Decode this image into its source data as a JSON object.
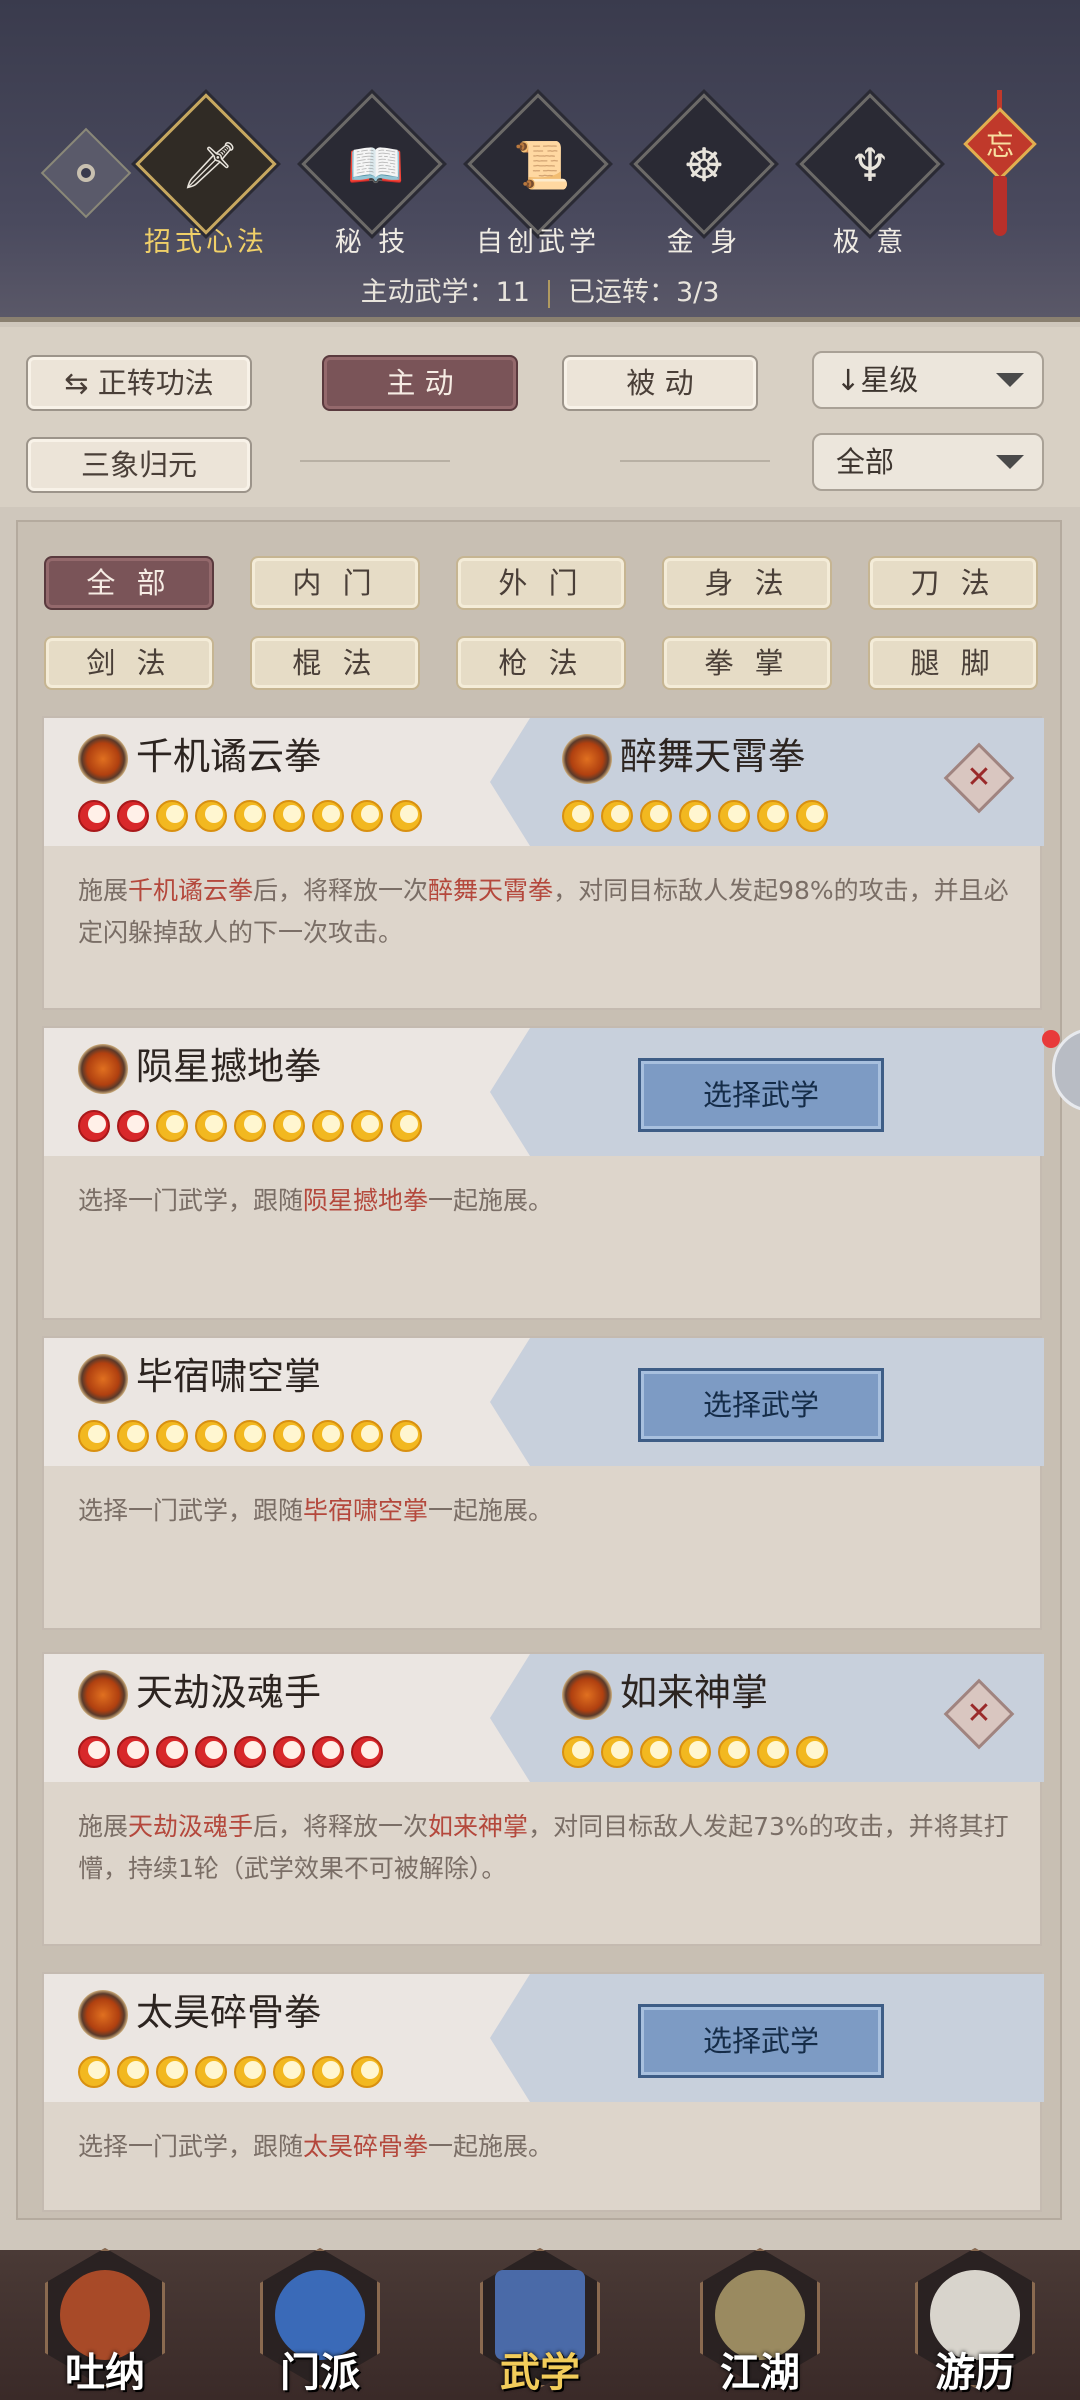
{
  "header": {
    "tabs": [
      {
        "label": "招式心法",
        "icon": "sword-icon",
        "selected": true
      },
      {
        "label": "秘 技",
        "icon": "scroll-book-icon",
        "selected": false
      },
      {
        "label": "自创武学",
        "icon": "rolled-scroll-icon",
        "selected": false
      },
      {
        "label": "金 身",
        "icon": "meditation-icon",
        "selected": false
      },
      {
        "label": "极 意",
        "icon": "martial-pose-icon",
        "selected": false
      }
    ],
    "knot_char": "忘",
    "active_label": "主动武学：11",
    "running_label": "已运转：3/3"
  },
  "filters": {
    "switch_label": "正转功法",
    "active_label": "主 动",
    "passive_label": "被 动",
    "sort_label": "星级",
    "mode_label": "三象归元",
    "all_label": "全部"
  },
  "categories": [
    "全 部",
    "内 门",
    "外 门",
    "身 法",
    "刀 法",
    "剑 法",
    "棍 法",
    "枪 法",
    "拳 掌",
    "腿 脚"
  ],
  "combos": [
    {
      "left_name": "千机谲云拳",
      "left_red": 2,
      "left_total": 9,
      "right_name": "醉舞天霄拳",
      "right_red": 0,
      "right_total": 7,
      "desc_pre": "施展",
      "desc_a": "千机谲云拳",
      "desc_mid": "后，将释放一次",
      "desc_b": "醉舞天霄拳",
      "desc_post": "，对同目标敌人发起98%的攻击，并且必定闪躲掉敌人的下一次攻击。"
    },
    {
      "left_name": "陨星撼地拳",
      "left_red": 2,
      "left_total": 9,
      "select_label": "选择武学",
      "desc_pre": "选择一门武学，跟随",
      "desc_a": "陨星撼地拳",
      "desc_post": "一起施展。"
    },
    {
      "left_name": "毕宿啸空掌",
      "left_red": 0,
      "left_total": 9,
      "select_label": "选择武学",
      "desc_pre": "选择一门武学，跟随",
      "desc_a": "毕宿啸空掌",
      "desc_post": "一起施展。"
    },
    {
      "left_name": "天劫汲魂手",
      "left_red": 8,
      "left_total": 8,
      "right_name": "如来神掌",
      "right_red": 0,
      "right_total": 7,
      "desc_pre": "施展",
      "desc_a": "天劫汲魂手",
      "desc_mid": "后，将释放一次",
      "desc_b": "如来神掌",
      "desc_post": "，对同目标敌人发起73%的攻击，并将其打懵，持续1轮（武学效果不可被解除）。"
    },
    {
      "left_name": "太昊碎骨拳",
      "left_red": 0,
      "left_total": 8,
      "select_label": "选择武学",
      "desc_pre": "选择一门武学，跟随",
      "desc_a": "太昊碎骨拳",
      "desc_post": "一起施展。"
    }
  ],
  "bottom_nav": [
    {
      "label": "吐纳",
      "icon": "monk-icon",
      "color": "#a84a28"
    },
    {
      "label": "门派",
      "icon": "banner-icon",
      "color": "#3a6ab8"
    },
    {
      "label": "武学",
      "icon": "manual-book-icon",
      "color": "#4a6aa8",
      "selected": true
    },
    {
      "label": "江湖",
      "icon": "bamboo-hat-icon",
      "color": "#9a8a60"
    },
    {
      "label": "游历",
      "icon": "horse-icon",
      "color": "#d8d4cc"
    }
  ]
}
